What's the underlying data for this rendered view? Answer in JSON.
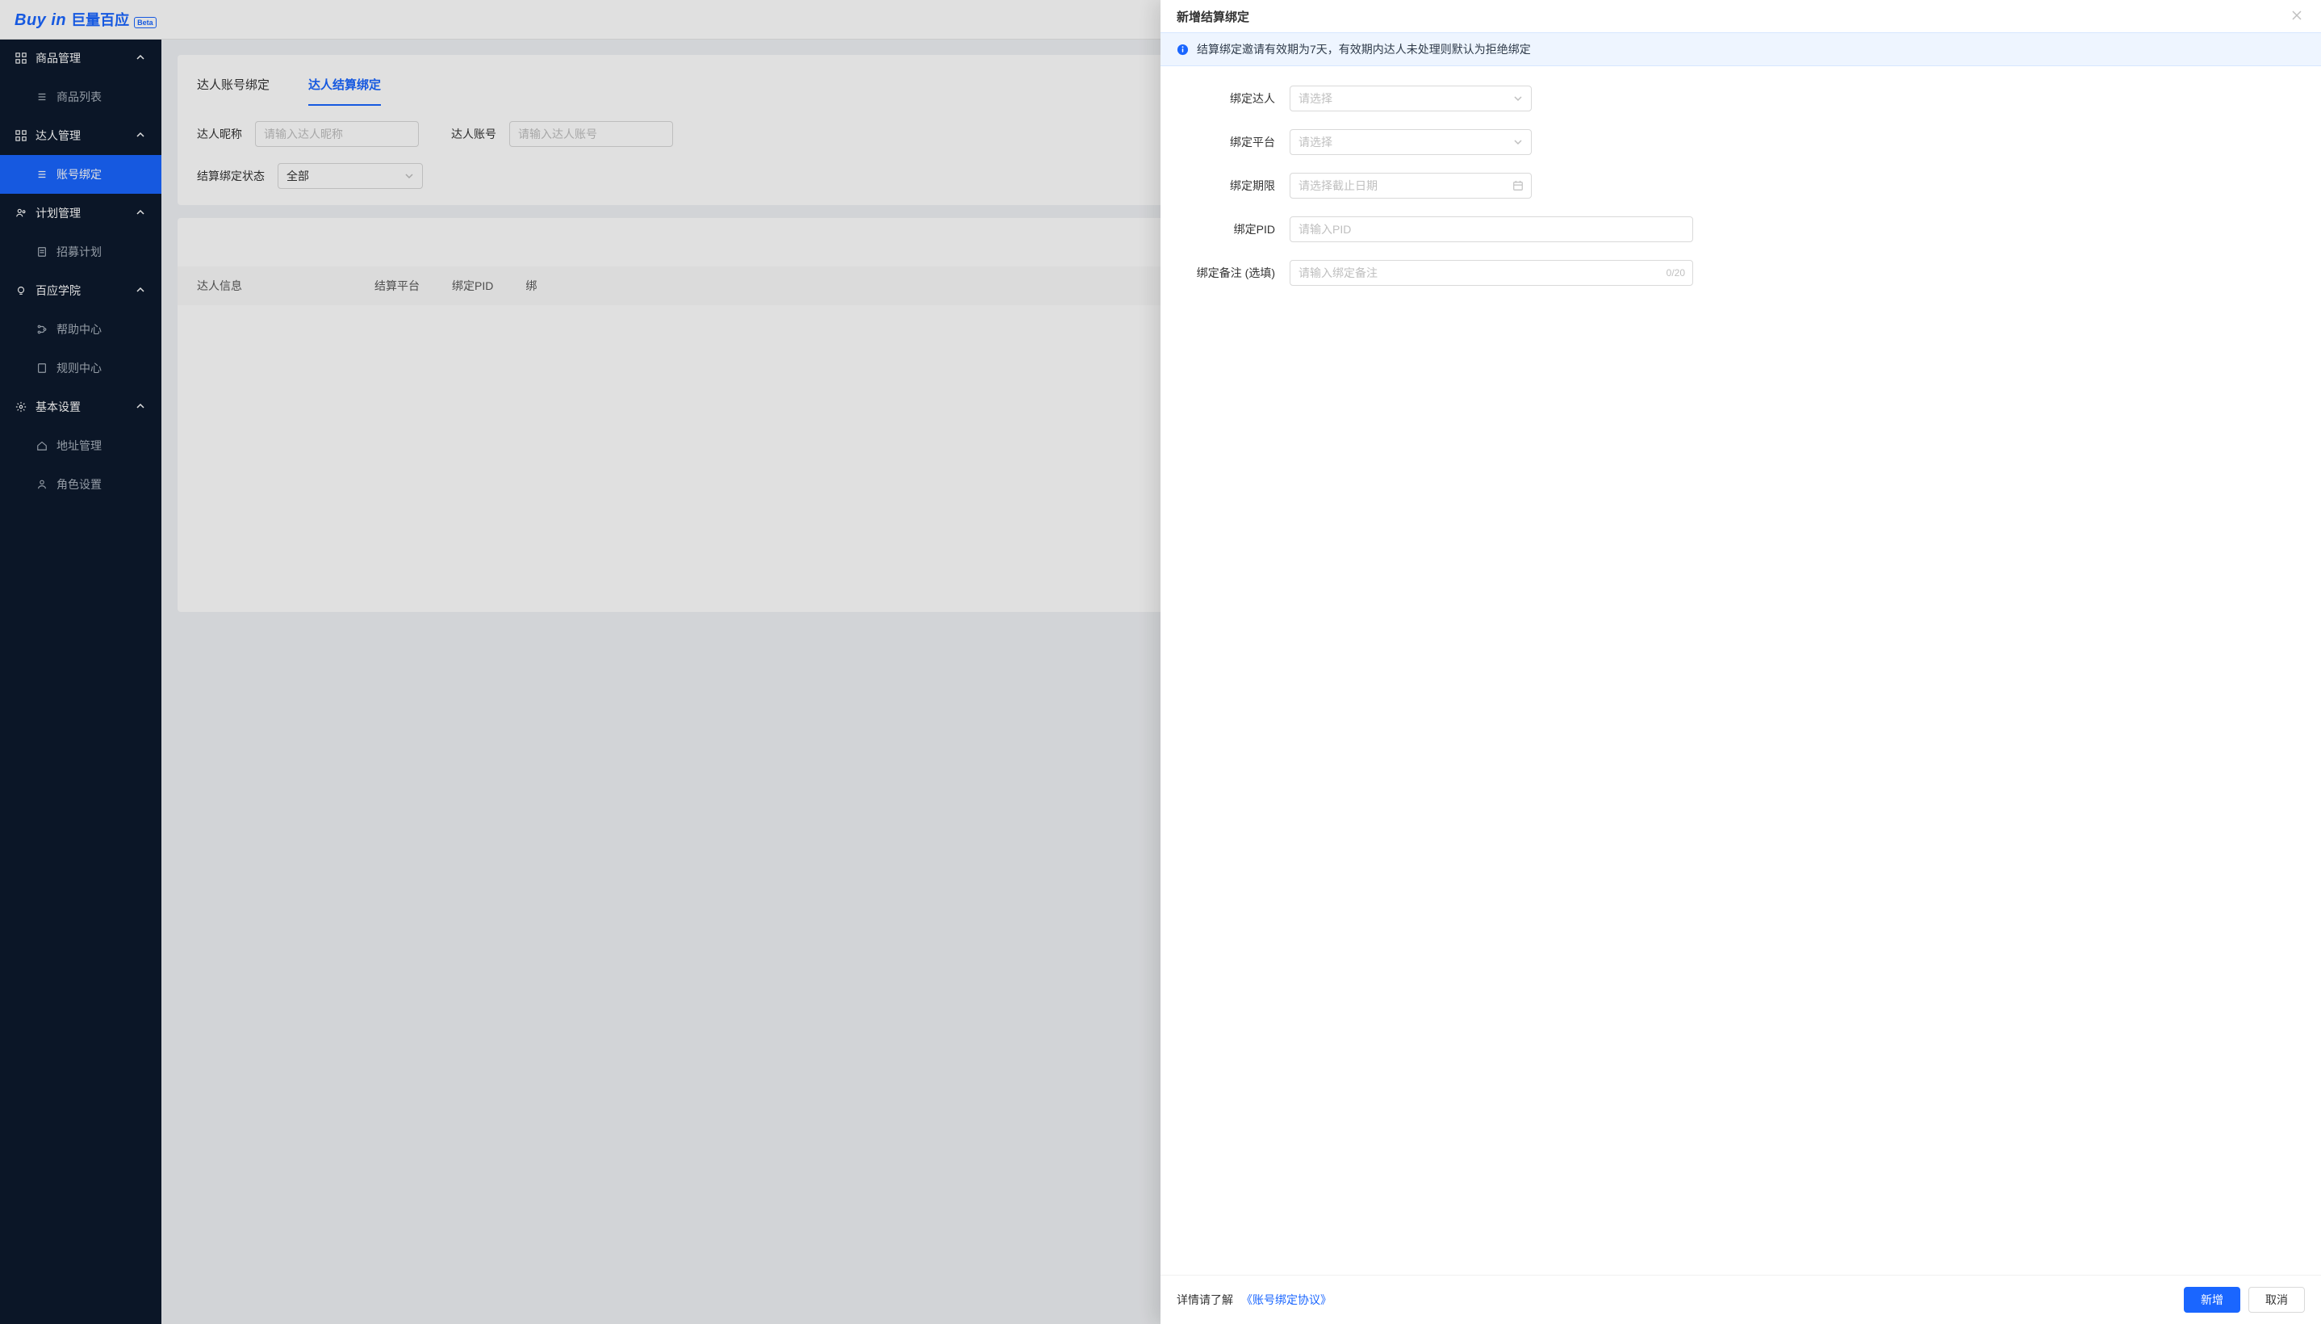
{
  "brand": {
    "en": "Buy in",
    "cn": "巨量百应",
    "beta": "Beta"
  },
  "sidebar": {
    "groups": [
      {
        "label": "商品管理",
        "items": [
          {
            "label": "商品列表",
            "icon": "list-icon"
          }
        ]
      },
      {
        "label": "达人管理",
        "items": [
          {
            "label": "账号绑定",
            "icon": "list-icon",
            "active": true
          }
        ]
      },
      {
        "label": "计划管理",
        "items": [
          {
            "label": "招募计划",
            "icon": "doc-icon"
          }
        ]
      },
      {
        "label": "百应学院",
        "items": [
          {
            "label": "帮助中心",
            "icon": "branch-icon"
          },
          {
            "label": "规则中心",
            "icon": "page-icon"
          }
        ]
      },
      {
        "label": "基本设置",
        "items": [
          {
            "label": "地址管理",
            "icon": "home-icon"
          },
          {
            "label": "角色设置",
            "icon": "user-icon"
          }
        ]
      }
    ]
  },
  "main": {
    "tabs": [
      {
        "label": "达人账号绑定",
        "active": false
      },
      {
        "label": "达人结算绑定",
        "active": true
      }
    ],
    "filters": {
      "nickname_label": "达人昵称",
      "nickname_placeholder": "请输入达人昵称",
      "account_label": "达人账号",
      "account_placeholder": "请输入达人账号",
      "status_label": "结算绑定状态",
      "status_value": "全部"
    },
    "table": {
      "columns": [
        "达人信息",
        "结算平台",
        "绑定PID",
        "绑"
      ]
    }
  },
  "drawer": {
    "title": "新增结算绑定",
    "notice": "结算绑定邀请有效期为7天，有效期内达人未处理则默认为拒绝绑定",
    "fields": {
      "author_label": "绑定达人",
      "author_placeholder": "请选择",
      "platform_label": "绑定平台",
      "platform_placeholder": "请选择",
      "period_label": "绑定期限",
      "period_placeholder": "请选择截止日期",
      "pid_label": "绑定PID",
      "pid_placeholder": "请输入PID",
      "remark_label": "绑定备注 (选填)",
      "remark_placeholder": "请输入绑定备注",
      "remark_counter": "0/20"
    },
    "footer": {
      "hint_prefix": "详情请了解",
      "link": "《账号绑定协议》",
      "primary": "新增",
      "cancel": "取消"
    }
  }
}
